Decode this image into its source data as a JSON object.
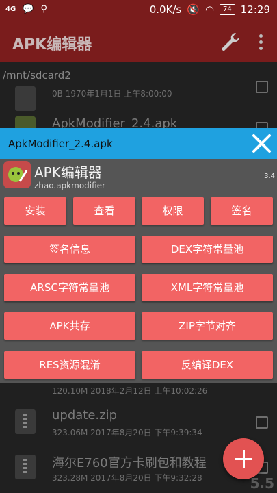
{
  "status": {
    "signal": "4G",
    "speed": "0.0K/s",
    "battery": "74",
    "time": "12:29"
  },
  "appbar": {
    "title": "APK编辑器"
  },
  "path": "/mnt/sdcard2",
  "files_above": [
    {
      "name": "",
      "meta": "0B    1970年1月1日 上午8:00:00"
    },
    {
      "name": "ApkModifier_2.4.apk",
      "meta": ""
    }
  ],
  "dialog": {
    "title": "ApkModifier_2.4.apk",
    "app_name": "APK编辑器",
    "package": "zhao.apkmodifier",
    "version": "3.4",
    "buttons_row1": [
      "安装",
      "查看",
      "权限",
      "签名"
    ],
    "buttons_grid": [
      "签名信息",
      "DEX字符常量池",
      "ARSC字符常量池",
      "XML字符常量池",
      "APK共存",
      "ZIP字节对齐",
      "RES资源混淆",
      "反编译DEX"
    ]
  },
  "files_below": [
    {
      "name": "",
      "meta": "120.10M    2018年2月12日 上午10:02:26"
    },
    {
      "name": "update.zip",
      "meta": "323.06M    2017年8月20日 下午9:39:34"
    },
    {
      "name": "海尔E760官方卡刷包和教程",
      "meta": "323.28M    2017年8月20日 下午9:32:28"
    }
  ],
  "watermark": "5.5",
  "colors": {
    "appbar": "#7a1c1c",
    "dialog_header": "#1fa1e0",
    "button": "#f26464",
    "fab": "#e25252"
  }
}
